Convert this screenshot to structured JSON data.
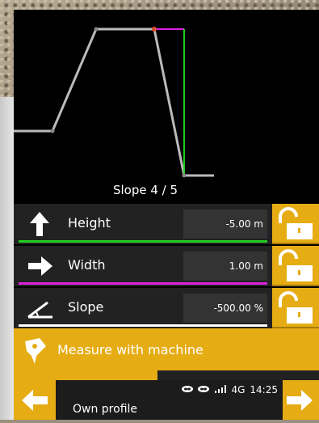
{
  "profile": {
    "slope_label": "Slope 4 / 5",
    "colors": {
      "line": "#bbbbbb",
      "width_marker": "#e020e0",
      "height_marker": "#22cc22",
      "point": "#e05030"
    }
  },
  "params": [
    {
      "label": "Height",
      "value": "-5.00 m",
      "icon": "arrow-up-icon",
      "line_color": "#22cc22",
      "locked": false
    },
    {
      "label": "Width",
      "value": "1.00 m",
      "icon": "arrow-right-icon",
      "line_color": "#e020e0",
      "locked": false
    },
    {
      "label": "Slope",
      "value": "-500.00 %",
      "icon": "slope-angle-icon",
      "line_color": "#ffffff",
      "locked": false
    }
  ],
  "measure": {
    "label": "Measure with machine",
    "icon": "machine-point-icon"
  },
  "progress": {
    "fraction": 0.47
  },
  "status": {
    "network": "4G",
    "time": "14:25",
    "profile_name": "Own profile"
  },
  "nav": {
    "back_icon": "arrow-left-icon",
    "forward_icon": "arrow-right-icon"
  },
  "accent_color": "#e6ac13"
}
